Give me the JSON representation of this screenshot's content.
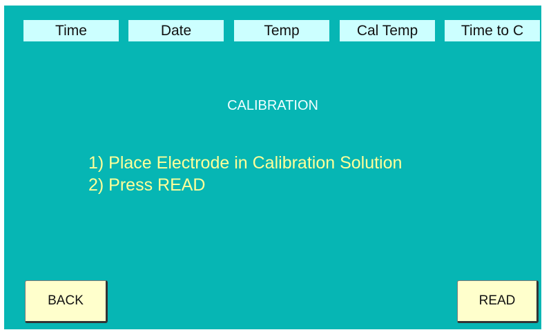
{
  "header": {
    "tabs": [
      {
        "label": "Time"
      },
      {
        "label": "Date"
      },
      {
        "label": "Temp"
      },
      {
        "label": "Cal Temp"
      },
      {
        "label": "Time to C"
      }
    ]
  },
  "main": {
    "title": "CALIBRATION",
    "steps": [
      "1) Place Electrode in Calibration Solution",
      "2) Press READ"
    ]
  },
  "footer": {
    "back_label": "BACK",
    "read_label": "READ"
  },
  "colors": {
    "background": "#06b6b4",
    "tab_background": "#ccffff",
    "instruction_text": "#ffff99",
    "button_background": "#ffffcc"
  }
}
